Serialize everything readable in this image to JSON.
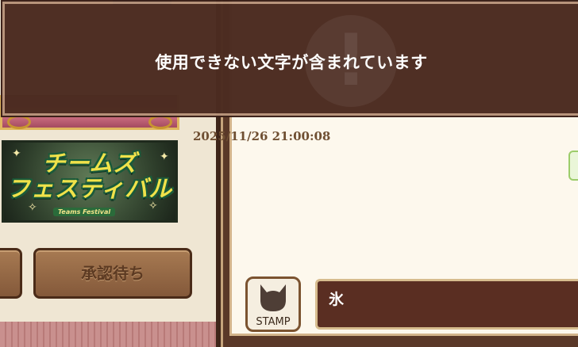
{
  "toast": {
    "message": "使用できない文字が含まれています",
    "icon": "exclamation-icon"
  },
  "left_panel": {
    "top_text": "~ ~~ ~ ~ ~",
    "festival_banner": {
      "title": "チームズ\nフェスティバル",
      "subtitle": "Teams Festival"
    },
    "approve_button": {
      "label": "承認待ち"
    }
  },
  "chat": {
    "timestamp": "2025/11/26 21:00:08",
    "stamp_button": {
      "label": "STAMP",
      "icon": "cat-icon"
    },
    "input": {
      "value": "氷"
    }
  },
  "colors": {
    "toast_bg": "#4c2c21",
    "frame_brown": "#5a3828",
    "chat_bg": "#fdf8ed",
    "festival_yellow": "#f0e24a"
  }
}
